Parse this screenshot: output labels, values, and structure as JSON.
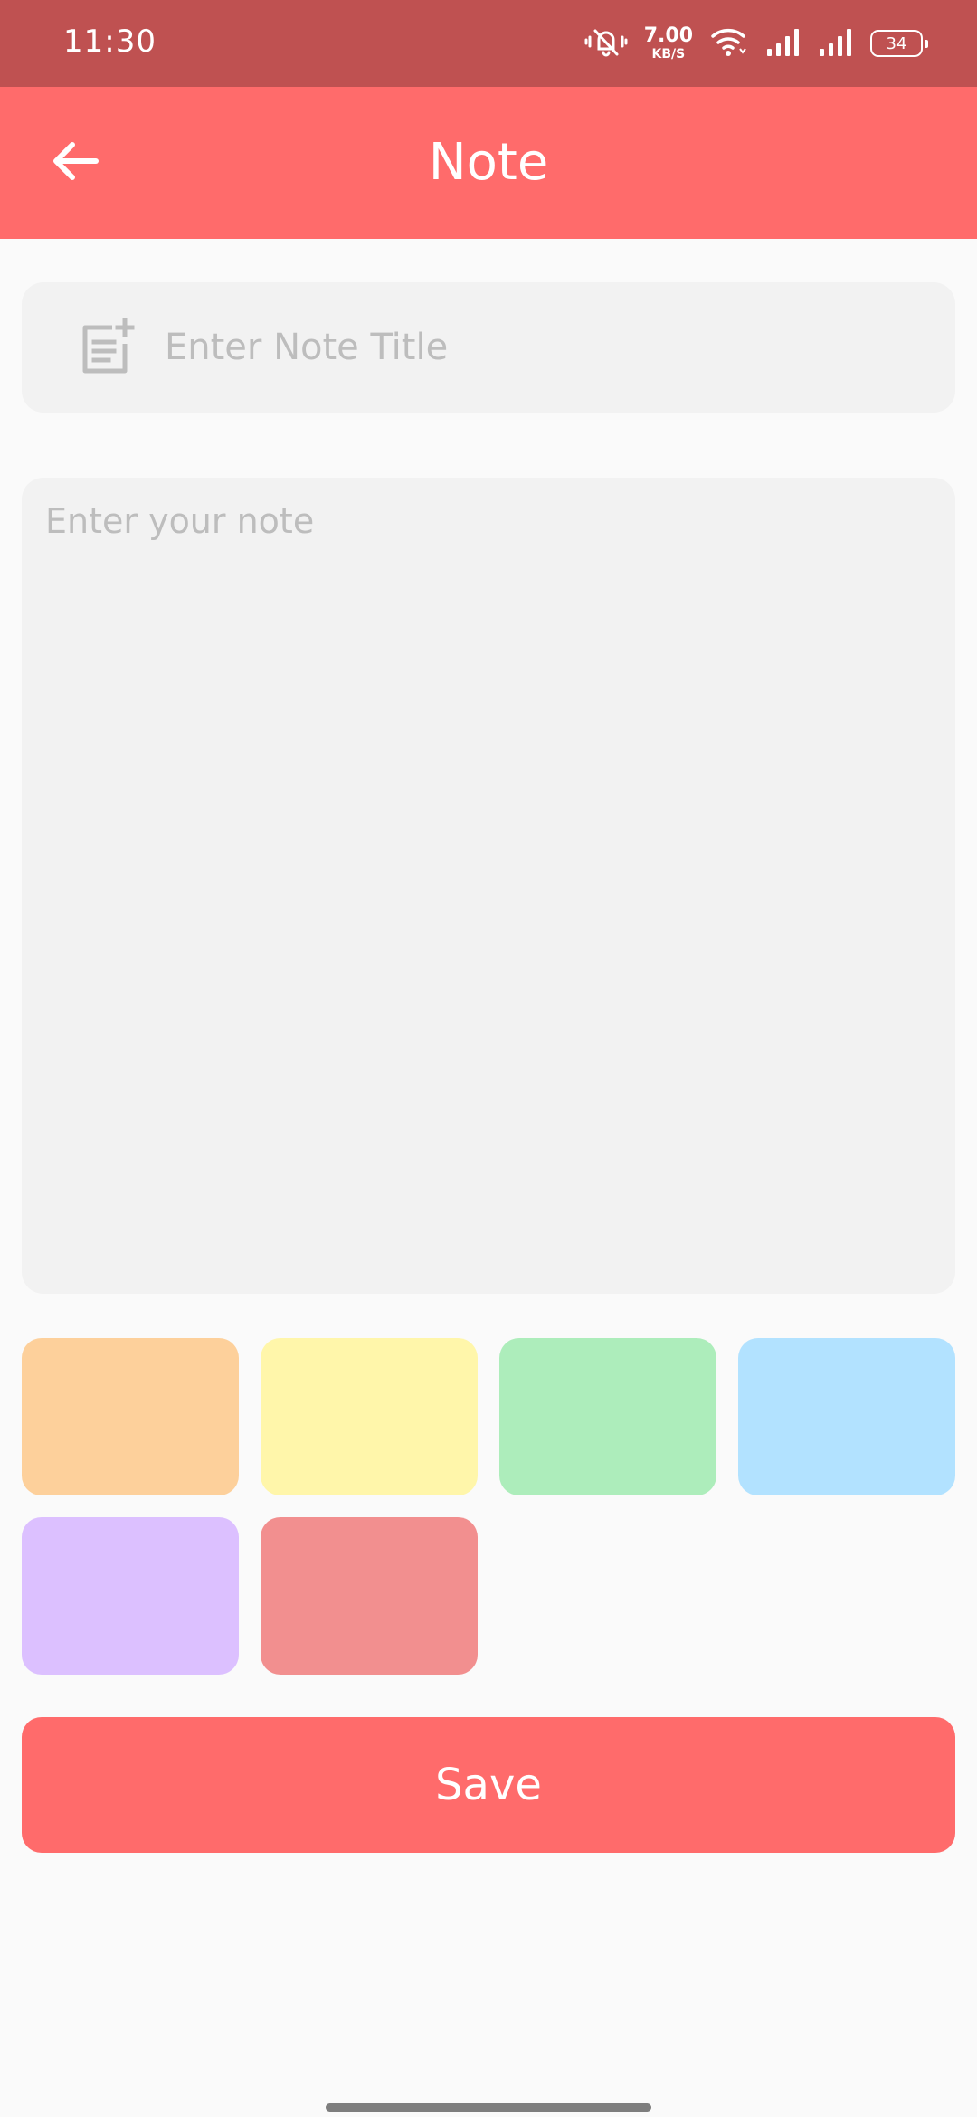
{
  "status_bar": {
    "time": "11:30",
    "net_speed_value": "7.00",
    "net_speed_unit": "KB/S",
    "battery_level": "34",
    "icons": [
      "vibrate-mute-icon",
      "wifi-icon",
      "signal-icon",
      "signal-icon",
      "battery-icon"
    ]
  },
  "app_bar": {
    "title": "Note",
    "back_icon": "arrow-left-icon"
  },
  "form": {
    "title_placeholder": "Enter Note Title",
    "title_value": "",
    "title_icon": "note-add-icon",
    "note_placeholder": "Enter your note",
    "note_value": ""
  },
  "colors": {
    "status_bar": "#BF5151",
    "app_bar": "#FF6B6B",
    "field_bg": "#F2F2F2",
    "page_bg": "#FAFAFA",
    "swatches": [
      "#FDD09B",
      "#FFF6AA",
      "#ADEDBB",
      "#B2E2FF",
      "#DCC0FF",
      "#F28F8F"
    ]
  },
  "actions": {
    "save_label": "Save"
  }
}
